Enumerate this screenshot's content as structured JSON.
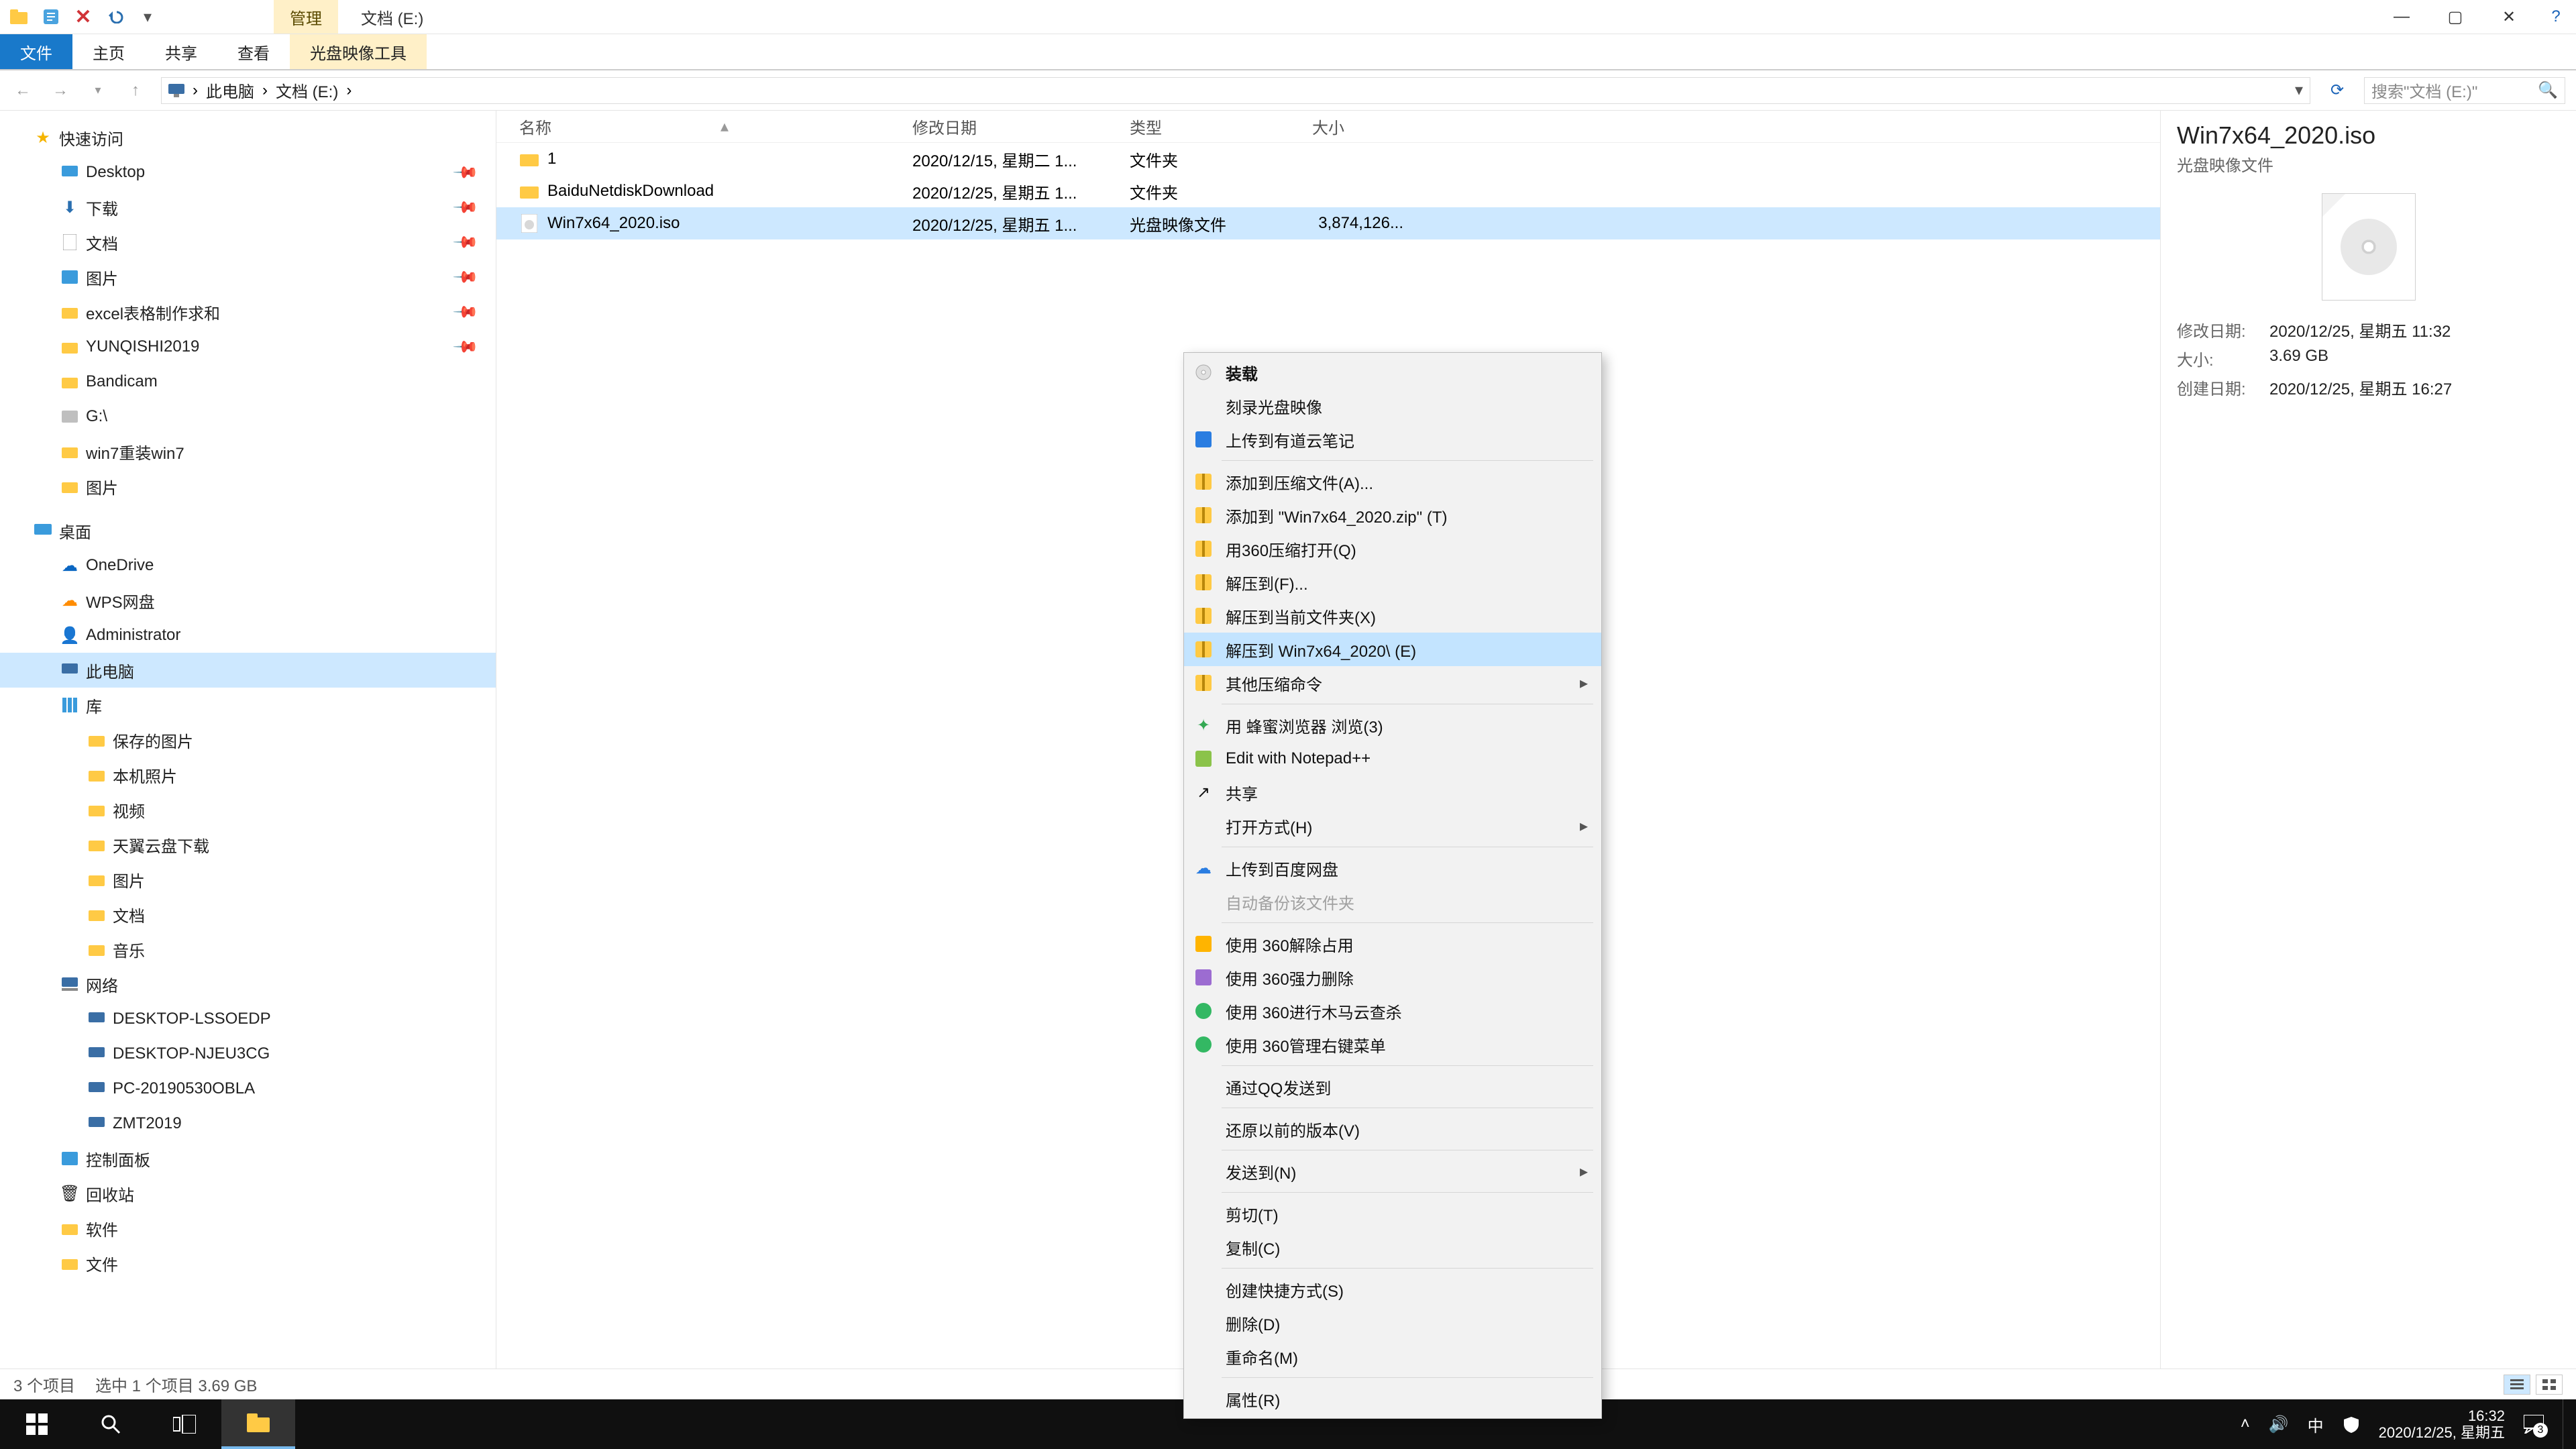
{
  "title_tab_manage": "管理",
  "title_right": "文档 (E:)",
  "ribbon": {
    "file": "文件",
    "home": "主页",
    "share": "共享",
    "view": "查看",
    "disc": "光盘映像工具"
  },
  "address": {
    "root": "此电脑",
    "drive": "文档 (E:)"
  },
  "search_placeholder": "搜索\"文档 (E:)\"",
  "tree": {
    "quick": "快速访问",
    "desktop": "Desktop",
    "downloads": "下载",
    "documents": "文档",
    "pictures": "图片",
    "excel": "excel表格制作求和",
    "yunqishi": "YUNQISHI2019",
    "bandicam": "Bandicam",
    "g": "G:\\",
    "win7reinstall": "win7重装win7",
    "pictures2": "图片",
    "desk_top": "桌面",
    "onedrive": "OneDrive",
    "wps": "WPS网盘",
    "admin": "Administrator",
    "thispc": "此电脑",
    "lib": "库",
    "saved": "保存的图片",
    "localphotos": "本机照片",
    "video": "视频",
    "tianyi": "天翼云盘下载",
    "pictures3": "图片",
    "documents2": "文档",
    "music": "音乐",
    "network": "网络",
    "d1": "DESKTOP-LSSOEDP",
    "d2": "DESKTOP-NJEU3CG",
    "d3": "PC-20190530OBLA",
    "d4": "ZMT2019",
    "ctrl": "控制面板",
    "recycle": "回收站",
    "software": "软件",
    "files": "文件"
  },
  "columns": {
    "name": "名称",
    "date": "修改日期",
    "type": "类型",
    "size": "大小"
  },
  "rows": [
    {
      "name": "1",
      "date": "2020/12/15, 星期二 1...",
      "type": "文件夹",
      "size": ""
    },
    {
      "name": "BaiduNetdiskDownload",
      "date": "2020/12/25, 星期五 1...",
      "type": "文件夹",
      "size": ""
    },
    {
      "name": "Win7x64_2020.iso",
      "date": "2020/12/25, 星期五 1...",
      "type": "光盘映像文件",
      "size": "3,874,126..."
    }
  ],
  "context": {
    "mount": "装载",
    "burn": "刻录光盘映像",
    "upload_youdao": "上传到有道云笔记",
    "add_archive": "添加到压缩文件(A)...",
    "add_zip": "添加到 \"Win7x64_2020.zip\" (T)",
    "open360": "用360压缩打开(Q)",
    "extractf": "解压到(F)...",
    "extract_here": "解压到当前文件夹(X)",
    "extract_named": "解压到 Win7x64_2020\\ (E)",
    "other_comp": "其他压缩命令",
    "open_fengmi": "用 蜂蜜浏览器 浏览(3)",
    "npp": "Edit with Notepad++",
    "share": "共享",
    "open_with": "打开方式(H)",
    "upload_baidu": "上传到百度网盘",
    "auto_backup": "自动备份该文件夹",
    "use360_unlock": "使用 360解除占用",
    "use360_force": "使用 360强力删除",
    "use360_trojan": "使用 360进行木马云查杀",
    "use360_menu": "使用 360管理右键菜单",
    "send_qq": "通过QQ发送到",
    "restore_prev": "还原以前的版本(V)",
    "sendto": "发送到(N)",
    "cut": "剪切(T)",
    "copy": "复制(C)",
    "create_shortcut": "创建快捷方式(S)",
    "delete": "删除(D)",
    "rename": "重命名(M)",
    "props": "属性(R)"
  },
  "details": {
    "title": "Win7x64_2020.iso",
    "sub": "光盘映像文件",
    "mdate_k": "修改日期:",
    "mdate_v": "2020/12/25, 星期五 11:32",
    "size_k": "大小:",
    "size_v": "3.69 GB",
    "cdate_k": "创建日期:",
    "cdate_v": "2020/12/25, 星期五 16:27"
  },
  "status": {
    "count": "3 个项目",
    "sel": "选中 1 个项目  3.69 GB"
  },
  "taskbar": {
    "ime": "中",
    "time": "16:32",
    "date": "2020/12/25, 星期五",
    "notif": "3"
  }
}
